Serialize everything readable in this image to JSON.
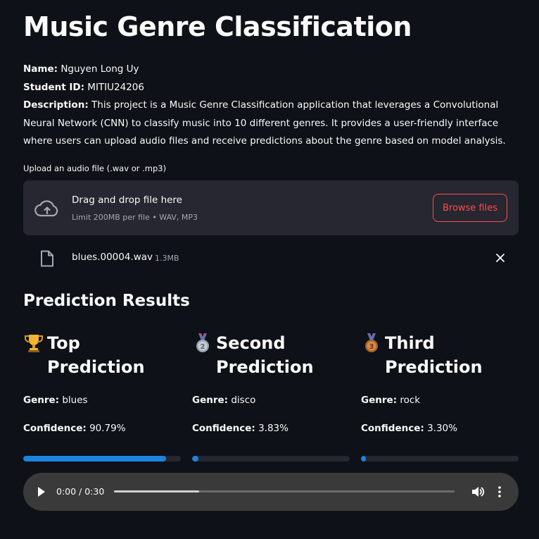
{
  "header": {
    "title": "Music Genre Classification"
  },
  "info": {
    "name_label": "Name:",
    "name_value": " Nguyen Long Uy",
    "id_label": "Student ID:",
    "id_value": " MITIU24206",
    "desc_label": "Description:",
    "desc_value": " This project is a Music Genre Classification application that leverages a Convolutional Neural Network (CNN) to classify music into 10 different genres. It provides a user-friendly interface where users can upload audio files and receive predictions about the genre based on model analysis."
  },
  "uploader": {
    "label": "Upload an audio file (.wav or .mp3)",
    "dropzone_title": "Drag and drop file here",
    "dropzone_limit": "Limit 200MB per file • WAV, MP3",
    "browse_label": "Browse files",
    "file_name": "blues.00004.wav",
    "file_size": "1.3MB",
    "upload_icon": "cloud-upload-icon",
    "file_icon": "file-icon",
    "close_icon": "close-icon"
  },
  "results": {
    "heading": "Prediction Results",
    "genre_label": "Genre:",
    "confidence_label": "Confidence:",
    "bar_color": "#1c83e1",
    "predictions": [
      {
        "emoji": "trophy-icon",
        "title": "Top Prediction",
        "genre": " blues",
        "confidence": " 90.79%",
        "confidence_fraction": 0.9079
      },
      {
        "emoji": "second-place-medal-icon",
        "title": "Second Prediction",
        "genre": " disco",
        "confidence": " 3.83%",
        "confidence_fraction": 0.0383
      },
      {
        "emoji": "third-place-medal-icon",
        "title": "Third Prediction",
        "genre": " rock",
        "confidence": " 3.30%",
        "confidence_fraction": 0.033
      }
    ]
  },
  "audio_player": {
    "time_display": "0:00 / 0:30",
    "buffered_fraction": 0.25,
    "play_icon": "play-icon",
    "volume_icon": "volume-icon",
    "more_icon": "more-vertical-icon"
  },
  "colors": {
    "background": "#0e1117",
    "surface": "#262730",
    "accent": "#ff4b4b",
    "progress": "#1c83e1"
  }
}
